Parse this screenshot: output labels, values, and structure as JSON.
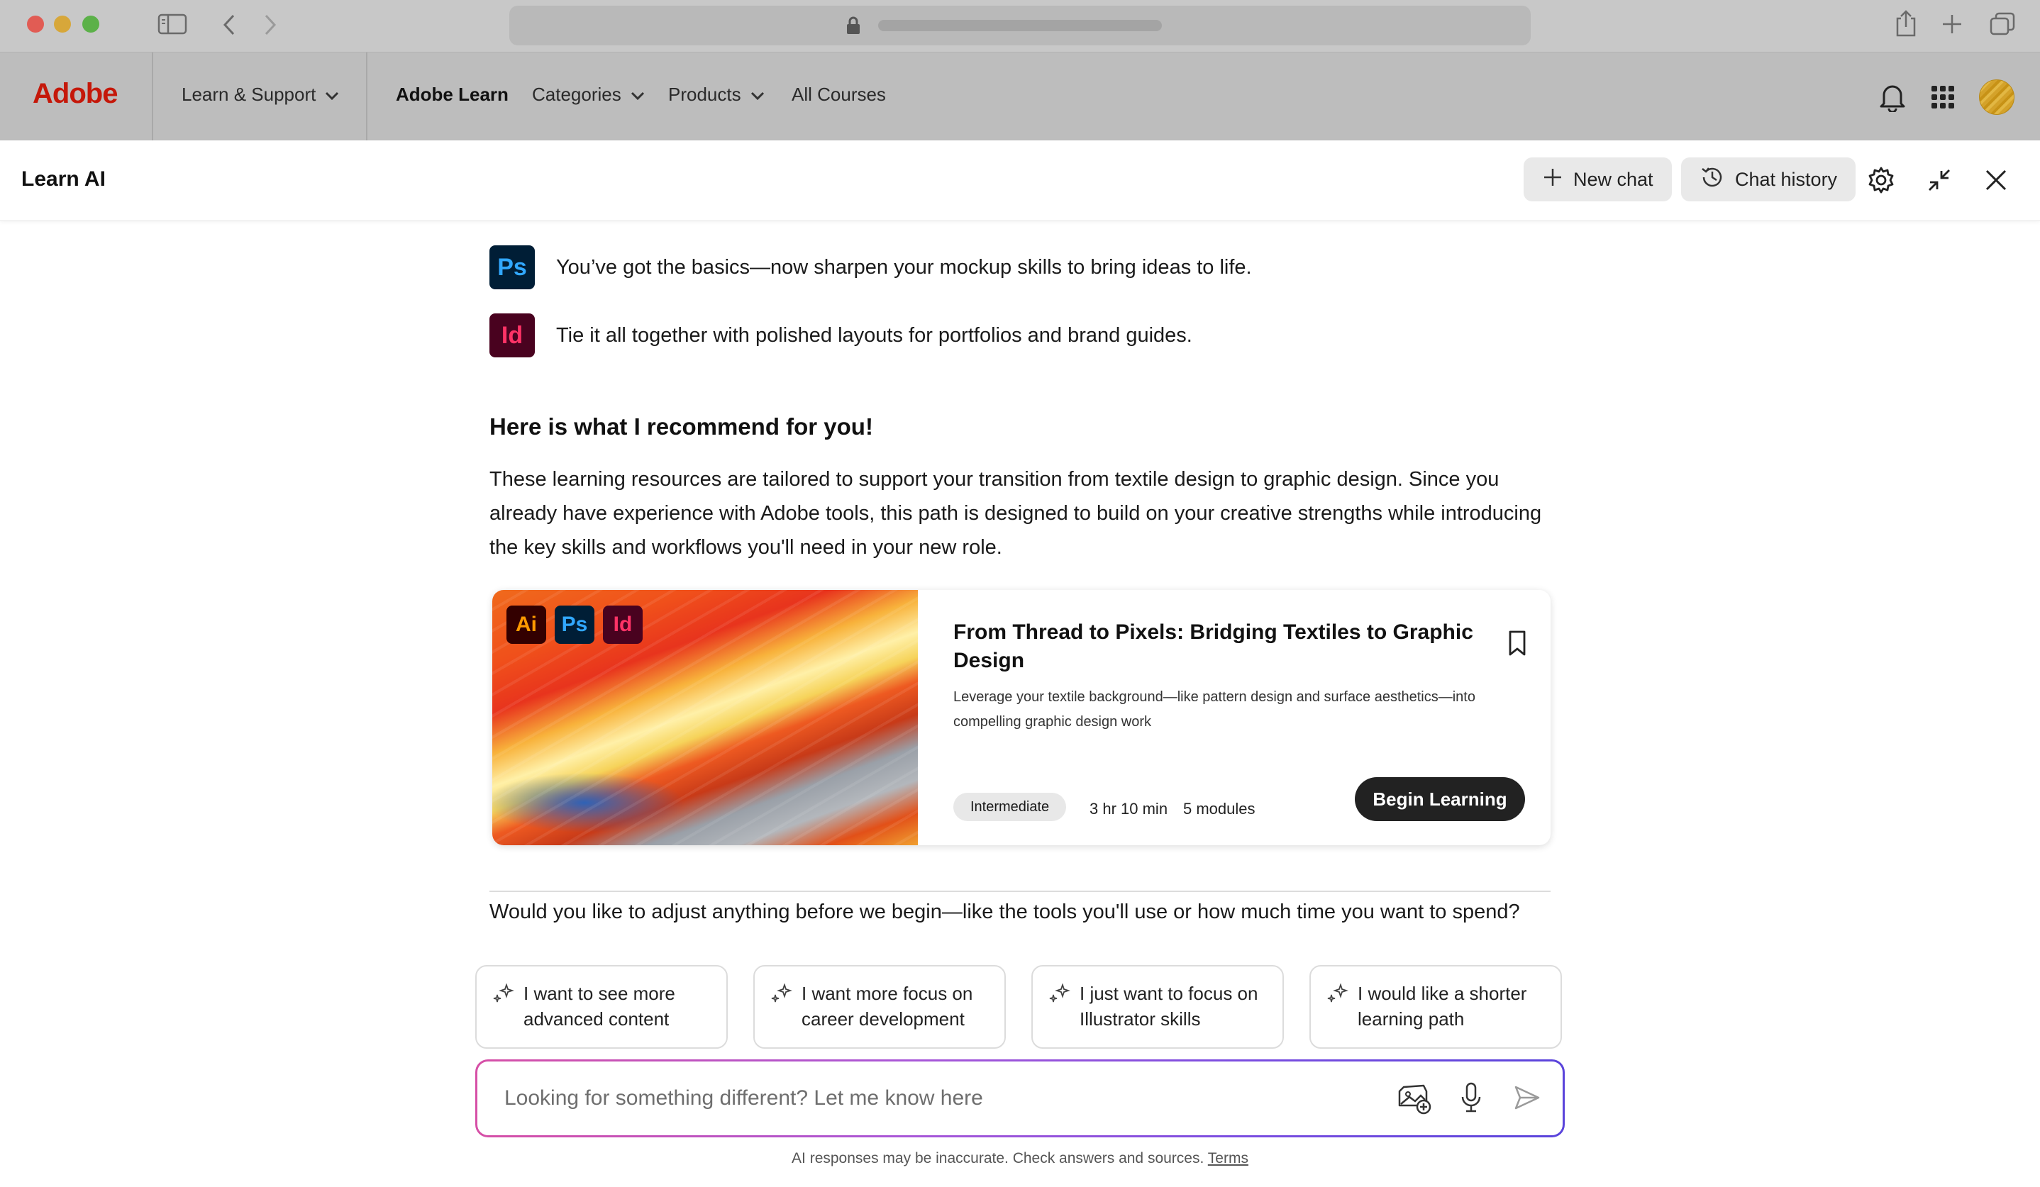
{
  "browser": {
    "icons": [
      "sidebar-icon",
      "back-icon",
      "forward-icon",
      "lock-icon",
      "share-icon",
      "new-tab-icon",
      "tabs-icon"
    ]
  },
  "nav": {
    "logo": "Adobe",
    "learn_support": "Learn & Support",
    "adobe_learn": "Adobe Learn",
    "categories": "Categories",
    "products": "Products",
    "all_courses": "All Courses"
  },
  "panel": {
    "title": "Learn AI",
    "new_chat": "New chat",
    "chat_history": "Chat history"
  },
  "chat": {
    "apps": [
      {
        "badge": "Ps",
        "text": "You’ve got the basics—now sharpen your mockup skills to bring ideas to life."
      },
      {
        "badge": "Id",
        "text": "Tie it all together with polished layouts for portfolios and brand guides."
      }
    ],
    "recommend_title": "Here is what I recommend for you!",
    "paragraph": "These learning resources are tailored to support your transition from textile design to graphic design. Since you already have experience with Adobe tools, this path is designed to build on your creative strengths while introducing the key skills and workflows you'll need in your new role.",
    "card": {
      "badges": [
        "Ai",
        "Ps",
        "Id"
      ],
      "title": "From Thread to Pixels: Bridging Textiles to Graphic Design",
      "description": "Leverage your textile background—like pattern design and surface aesthetics—into compelling graphic design work",
      "level": "Intermediate",
      "duration": "3 hr 10 min",
      "modules": "5 modules",
      "cta": "Begin Learning"
    },
    "question": "Would you like to adjust anything before we begin—like the tools you'll use or how much time you want to spend?",
    "suggestions": [
      "I want to see more advanced content",
      "I want more focus on career development",
      "I just want to focus on Illustrator skills",
      "I would like a shorter learning path"
    ]
  },
  "input": {
    "placeholder": "Looking for something different? Let me know here",
    "value": ""
  },
  "footer": {
    "disclaimer": "AI responses may be inaccurate. Check answers and sources.",
    "terms": "Terms"
  },
  "colors": {
    "adobe_red": "#c5180a",
    "ps_bg": "#001e36",
    "ps_fg": "#31a8ff",
    "id_bg": "#49021f",
    "id_fg": "#ff3366",
    "ai_bg": "#330000",
    "ai_fg": "#ff9a00",
    "primary_button": "#222222"
  }
}
